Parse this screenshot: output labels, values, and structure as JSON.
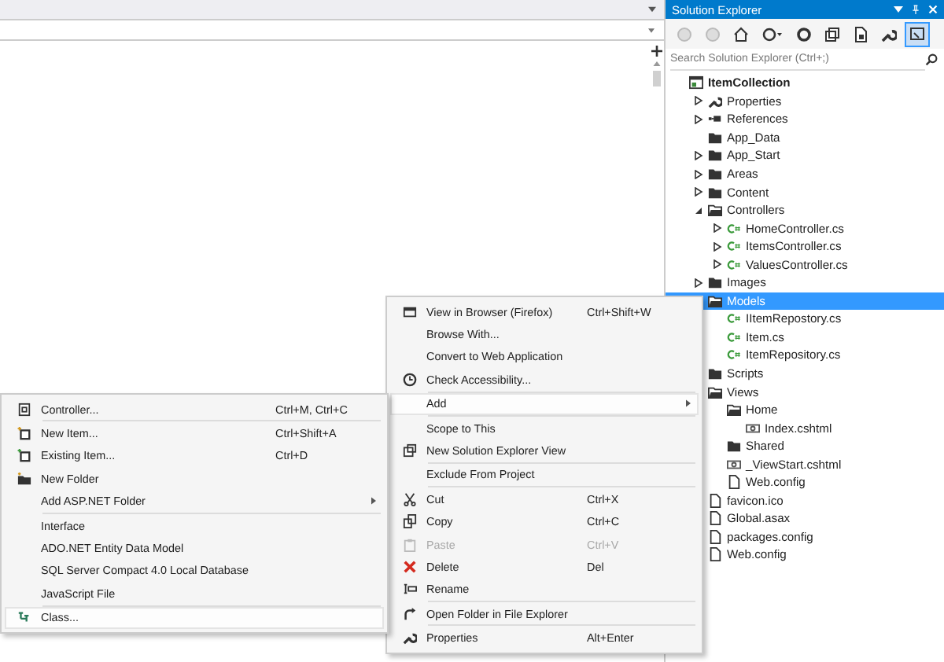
{
  "explorer": {
    "title": "Solution Explorer",
    "search_placeholder": "Search Solution Explorer (Ctrl+;)",
    "toolbar": [
      {
        "kind": "back",
        "selected": false
      },
      {
        "kind": "forward",
        "selected": false
      },
      {
        "kind": "home",
        "selected": false
      },
      {
        "kind": "history",
        "selected": false
      },
      {
        "kind": "refresh",
        "selected": false
      },
      {
        "kind": "collapse",
        "selected": false
      },
      {
        "kind": "showall",
        "selected": false
      },
      {
        "kind": "properties",
        "selected": false
      },
      {
        "kind": "preview",
        "selected": true
      }
    ],
    "tree": [
      {
        "label": "ItemCollection",
        "kind": "project",
        "selected": false,
        "children": [
          {
            "label": "Properties",
            "kind": "properties",
            "expanded": false,
            "selected": false
          },
          {
            "label": "References",
            "kind": "references",
            "expanded": false,
            "selected": false
          },
          {
            "label": "App_Data",
            "kind": "folder",
            "selected": false
          },
          {
            "label": "App_Start",
            "kind": "folder",
            "expanded": false,
            "selected": false
          },
          {
            "label": "Areas",
            "kind": "folder",
            "expanded": false,
            "selected": false
          },
          {
            "label": "Content",
            "kind": "folder",
            "expanded": false,
            "selected": false
          },
          {
            "label": "Controllers",
            "kind": "openfolder",
            "expanded": true,
            "selected": false,
            "children": [
              {
                "label": "HomeController.cs",
                "kind": "cs",
                "expanded": false,
                "selected": false
              },
              {
                "label": "ItemsController.cs",
                "kind": "cs",
                "expanded": false,
                "selected": false
              },
              {
                "label": "ValuesController.cs",
                "kind": "cs",
                "expanded": false,
                "selected": false
              }
            ]
          },
          {
            "label": "Images",
            "kind": "folder",
            "expanded": false,
            "selected": false
          },
          {
            "label": "Models",
            "kind": "openfolder",
            "selected": true,
            "children": [
              {
                "label": "IItemRepostory.cs",
                "kind": "cs",
                "selected": false
              },
              {
                "label": "Item.cs",
                "kind": "cs",
                "selected": false
              },
              {
                "label": "ItemRepository.cs",
                "kind": "cs",
                "selected": false
              }
            ]
          },
          {
            "label": "Scripts",
            "kind": "folder",
            "selected": false
          },
          {
            "label": "Views",
            "kind": "openfolder",
            "selected": false,
            "children": [
              {
                "label": "Home",
                "kind": "openfolder",
                "selected": false,
                "children": [
                  {
                    "label": "Index.cshtml",
                    "kind": "cshtml",
                    "selected": false
                  }
                ]
              },
              {
                "label": "Shared",
                "kind": "folder",
                "selected": false
              },
              {
                "label": "_ViewStart.cshtml",
                "kind": "cshtml",
                "selected": false
              },
              {
                "label": "Web.config",
                "kind": "config",
                "selected": false
              }
            ]
          },
          {
            "label": "favicon.ico",
            "kind": "file",
            "selected": false
          },
          {
            "label": "Global.asax",
            "kind": "file",
            "selected": false
          },
          {
            "label": "packages.config",
            "kind": "file",
            "selected": false
          },
          {
            "label": "Web.config",
            "kind": "file",
            "selected": false
          }
        ]
      }
    ]
  },
  "context_menu": [
    {
      "kind": "browser",
      "label": "View in Browser (Firefox)",
      "shortcut": "Ctrl+Shift+W",
      "selected": false,
      "disabled": false
    },
    {
      "kind": "plain",
      "label": "Browse With...",
      "selected": false,
      "disabled": false
    },
    {
      "kind": "plain",
      "label": "Convert to Web Application",
      "selected": false,
      "disabled": false
    },
    {
      "kind": "accessibility",
      "label": "Check Accessibility...",
      "selected": false,
      "disabled": false
    },
    {
      "kind": "separator"
    },
    {
      "kind": "plain",
      "label": "Add",
      "submenu": true,
      "selected": true,
      "disabled": false
    },
    {
      "kind": "separator"
    },
    {
      "kind": "plain",
      "label": "Scope to This",
      "selected": false,
      "disabled": false
    },
    {
      "kind": "window",
      "label": "New Solution Explorer View",
      "selected": false,
      "disabled": false
    },
    {
      "kind": "separator"
    },
    {
      "kind": "plain",
      "label": "Exclude From Project",
      "selected": false,
      "disabled": false
    },
    {
      "kind": "separator"
    },
    {
      "kind": "cut",
      "label": "Cut",
      "shortcut": "Ctrl+X",
      "selected": false,
      "disabled": false
    },
    {
      "kind": "copy",
      "label": "Copy",
      "shortcut": "Ctrl+C",
      "selected": false,
      "disabled": false
    },
    {
      "kind": "paste",
      "label": "Paste",
      "shortcut": "Ctrl+V",
      "selected": false,
      "disabled": true
    },
    {
      "kind": "delete",
      "label": "Delete",
      "shortcut": "Del",
      "selected": false,
      "disabled": false
    },
    {
      "kind": "rename",
      "label": "Rename",
      "selected": false,
      "disabled": false
    },
    {
      "kind": "separator"
    },
    {
      "kind": "open",
      "label": "Open Folder in File Explorer",
      "selected": false,
      "disabled": false
    },
    {
      "kind": "separator"
    },
    {
      "kind": "wrench",
      "label": "Properties",
      "shortcut": "Alt+Enter",
      "selected": false,
      "disabled": false
    }
  ],
  "add_submenu": [
    {
      "kind": "controller",
      "label": "Controller...",
      "shortcut": "Ctrl+M, Ctrl+C",
      "selected": false,
      "disabled": false
    },
    {
      "kind": "separator"
    },
    {
      "kind": "newitem",
      "label": "New Item...",
      "shortcut": "Ctrl+Shift+A",
      "selected": false,
      "disabled": false
    },
    {
      "kind": "existingitem",
      "label": "Existing Item...",
      "shortcut": "Ctrl+D",
      "selected": false,
      "disabled": false
    },
    {
      "kind": "folder",
      "label": "New Folder",
      "selected": false,
      "disabled": false
    },
    {
      "kind": "plain",
      "label": "Add ASP.NET Folder",
      "submenu": true,
      "selected": false,
      "disabled": false
    },
    {
      "kind": "separator"
    },
    {
      "kind": "plain",
      "label": "Interface",
      "selected": false,
      "disabled": false
    },
    {
      "kind": "plain",
      "label": "ADO.NET Entity Data Model",
      "selected": false,
      "disabled": false
    },
    {
      "kind": "plain",
      "label": "SQL Server Compact 4.0 Local Database",
      "selected": false,
      "disabled": false
    },
    {
      "kind": "plain",
      "label": "JavaScript File",
      "selected": false,
      "disabled": false
    },
    {
      "kind": "separator"
    },
    {
      "kind": "class",
      "label": "Class...",
      "selected": true,
      "disabled": false
    }
  ]
}
